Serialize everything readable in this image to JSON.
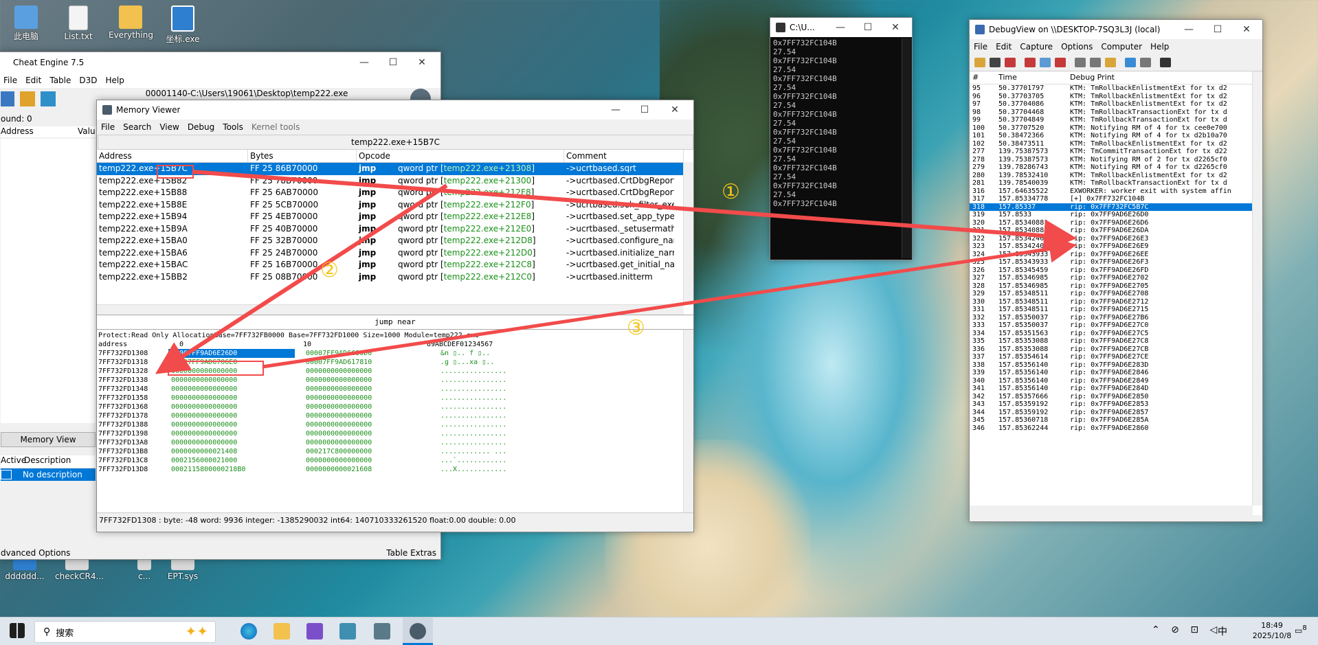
{
  "desktop_icons": [
    {
      "label": "此电脑"
    },
    {
      "label": "List.txt"
    },
    {
      "label": "Everything"
    },
    {
      "label": "坐标.exe"
    },
    {
      "label": "dddddd..."
    },
    {
      "label": "checkCR4..."
    },
    {
      "label": "c..."
    },
    {
      "label": "EPT.sys"
    }
  ],
  "cheat_engine": {
    "title": "Cheat Engine 7.5",
    "menu": [
      "File",
      "Edit",
      "Table",
      "D3D",
      "Help"
    ],
    "process": "00001140-C:\\Users\\19061\\Desktop\\temp222.exe",
    "found": "ound: 0",
    "col_address": "Address",
    "col_value": "Valu",
    "memory_view_button": "Memory View",
    "table_cols": [
      "Active",
      "Description"
    ],
    "table_row": "No description",
    "advanced_options": "dvanced Options",
    "table_extras": "Table Extras"
  },
  "memory_viewer": {
    "title": "Memory Viewer",
    "menu": [
      "File",
      "Search",
      "View",
      "Debug",
      "Tools",
      "Kernel tools"
    ],
    "address_bar": "temp222.exe+15B7C",
    "columns": [
      "Address",
      "Bytes",
      "Opcode",
      "Comment"
    ],
    "rows": [
      {
        "addr": "temp222.exe+15B7C",
        "bytes": "FF 25 86B70000",
        "op": "jmp",
        "pre": "qword ptr [",
        "target": "temp222.exe+21308",
        "post": "]",
        "comment": "->ucrtbased.sqrt"
      },
      {
        "addr": "temp222.exe+15B82",
        "bytes": "FF 25 78B70000",
        "op": "jmp",
        "pre": "qword ptr [",
        "target": "temp222.exe+21300",
        "post": "]",
        "comment": "->ucrtbased.CrtDbgReport"
      },
      {
        "addr": "temp222.exe+15B88",
        "bytes": "FF 25 6AB70000",
        "op": "jmp",
        "pre": "qword ptr [",
        "target": "temp222.exe+212F8",
        "post": "]",
        "comment": "->ucrtbased.CrtDbgReportW"
      },
      {
        "addr": "temp222.exe+15B8E",
        "bytes": "FF 25 5CB70000",
        "op": "jmp",
        "pre": "qword ptr [",
        "target": "temp222.exe+212F0",
        "post": "]",
        "comment": "->ucrtbased.seh_filter_exe"
      },
      {
        "addr": "temp222.exe+15B94",
        "bytes": "FF 25 4EB70000",
        "op": "jmp",
        "pre": "qword ptr [",
        "target": "temp222.exe+212E8",
        "post": "]",
        "comment": "->ucrtbased.set_app_type"
      },
      {
        "addr": "temp222.exe+15B9A",
        "bytes": "FF 25 40B70000",
        "op": "jmp",
        "pre": "qword ptr [",
        "target": "temp222.exe+212E0",
        "post": "]",
        "comment": "->ucrtbased._setusermathe"
      },
      {
        "addr": "temp222.exe+15BA0",
        "bytes": "FF 25 32B70000",
        "op": "jmp",
        "pre": "qword ptr [",
        "target": "temp222.exe+212D8",
        "post": "]",
        "comment": "->ucrtbased.configure_narr"
      },
      {
        "addr": "temp222.exe+15BA6",
        "bytes": "FF 25 24B70000",
        "op": "jmp",
        "pre": "qword ptr [",
        "target": "temp222.exe+212D0",
        "post": "]",
        "comment": "->ucrtbased.initialize_narrov"
      },
      {
        "addr": "temp222.exe+15BAC",
        "bytes": "FF 25 16B70000",
        "op": "jmp",
        "pre": "qword ptr [",
        "target": "temp222.exe+212C8",
        "post": "]",
        "comment": "->ucrtbased.get_initial_narr"
      },
      {
        "addr": "temp222.exe+15BB2",
        "bytes": "FF 25 08B70000",
        "op": "jmp",
        "pre": "qword ptr [",
        "target": "temp222.exe+212C0",
        "post": "]",
        "comment": "->ucrtbased.initterm"
      }
    ],
    "status_instr": "jump near",
    "hex_header": "Protect:Read Only  AllocationBase=7FF732FB0000 Base=7FF732FD1000 Size=1000 Module=temp222.exe",
    "hex_cols": [
      "address",
      "0",
      "10",
      "89ABCDEF01234567"
    ],
    "hex_rows": [
      {
        "addr": "7FF732FD1308",
        "a": "00007FF9AD6E26D0",
        "b": "00007FF9AD6690D0",
        "ascii": "&n  ▯..  f  ▯.."
      },
      {
        "addr": "7FF732FD1318",
        "a": "00007FF9AD6706E0",
        "b": "00007FF9AD617810",
        "ascii": ".g  ▯...xa  ▯.."
      },
      {
        "addr": "7FF732FD1328",
        "a": "0000000000000000",
        "b": "0000000000000000",
        "ascii": "................"
      },
      {
        "addr": "7FF732FD1338",
        "a": "0000000000000000",
        "b": "0000000000000000",
        "ascii": "................"
      },
      {
        "addr": "7FF732FD1348",
        "a": "0000000000000000",
        "b": "0000000000000000",
        "ascii": "................"
      },
      {
        "addr": "7FF732FD1358",
        "a": "0000000000000000",
        "b": "0000000000000000",
        "ascii": "................"
      },
      {
        "addr": "7FF732FD1368",
        "a": "0000000000000000",
        "b": "0000000000000000",
        "ascii": "................"
      },
      {
        "addr": "7FF732FD1378",
        "a": "0000000000000000",
        "b": "0000000000000000",
        "ascii": "................"
      },
      {
        "addr": "7FF732FD1388",
        "a": "0000000000000000",
        "b": "0000000000000000",
        "ascii": "................"
      },
      {
        "addr": "7FF732FD1398",
        "a": "0000000000000000",
        "b": "0000000000000000",
        "ascii": "................"
      },
      {
        "addr": "7FF732FD13A8",
        "a": "0000000000000000",
        "b": "0000000000000000",
        "ascii": "................"
      },
      {
        "addr": "7FF732FD13B8",
        "a": "0000000000021408",
        "b": "000217C800000000",
        "ascii": "............ ..."
      },
      {
        "addr": "7FF732FD13C8",
        "a": "0002156000021000",
        "b": "0000000000000000",
        "ascii": "...`............"
      },
      {
        "addr": "7FF732FD13D8",
        "a": "0002115800000218B0",
        "b": "0000000000021608",
        "ascii": "...X............"
      }
    ],
    "status_bar": "7FF732FD1308 : byte: -48 word: 9936 integer: -1385290032 int64: 140710333261520 float:0.00 double: 0.00"
  },
  "console": {
    "title": "C:\\U...",
    "lines": [
      "0x7FF732FC104B",
      "27.54",
      "0x7FF732FC104B",
      "27.54",
      "0x7FF732FC104B",
      "27.54",
      "0x7FF732FC104B",
      "27.54",
      "0x7FF732FC104B",
      "27.54",
      "0x7FF732FC104B",
      "27.54",
      "0x7FF732FC104B",
      "27.54",
      "0x7FF732FC104B",
      "27.54",
      "0x7FF732FC104B",
      "27.54",
      "0x7FF732FC104B"
    ]
  },
  "debugview": {
    "title": "DebugView on \\\\DESKTOP-7SQ3L3J (local)",
    "menu": [
      "File",
      "Edit",
      "Capture",
      "Options",
      "Computer",
      "Help"
    ],
    "columns": [
      "#",
      "Time",
      "Debug Print"
    ],
    "rows": [
      {
        "n": "95",
        "t": "50.37701797",
        "m": "KTM:  TmRollbackEnlistmentExt for tx d2"
      },
      {
        "n": "96",
        "t": "50.37703705",
        "m": "KTM:  TmRollbackEnlistmentExt for tx d2"
      },
      {
        "n": "97",
        "t": "50.37704086",
        "m": "KTM:  TmRollbackEnlistmentExt for tx d2"
      },
      {
        "n": "98",
        "t": "50.37704468",
        "m": "KTM:  TmRollbackTransactionExt for tx d"
      },
      {
        "n": "99",
        "t": "50.37704849",
        "m": "KTM:  TmRollbackTransactionExt for tx d"
      },
      {
        "n": "100",
        "t": "50.37707520",
        "m": "KTM:  Notifying RM of 4 for tx cee0e700"
      },
      {
        "n": "101",
        "t": "50.38472366",
        "m": "KTM:  Notifying RM of 4 for tx d2b10a70"
      },
      {
        "n": "102",
        "t": "50.38473511",
        "m": "KTM:  TmRollbackEnlistmentExt for tx d2"
      },
      {
        "n": "277",
        "t": "139.75387573",
        "m": "KTM:  TmCommitTransactionExt for tx d22"
      },
      {
        "n": "278",
        "t": "139.75387573",
        "m": "KTM:  Notifying RM of 2 for tx d2265cf0"
      },
      {
        "n": "279",
        "t": "139.78286743",
        "m": "KTM:  Notifying RM of 4 for tx d2265cf0"
      },
      {
        "n": "280",
        "t": "139.78532410",
        "m": "KTM:  TmRollbackEnlistmentExt for tx d2"
      },
      {
        "n": "281",
        "t": "139.78540039",
        "m": "KTM:  TmRollbackTransactionExt for tx d"
      },
      {
        "n": "316",
        "t": "157.64635522",
        "m": "EXWORKER: worker exit with system affin"
      },
      {
        "n": "317",
        "t": "157.85334778",
        "m": "[+] 0x7FF732FC104B"
      },
      {
        "n": "318",
        "t": "157.85337",
        "m": "rip: 0x7FF732FC5B7C"
      },
      {
        "n": "319",
        "t": "157.8533",
        "m": "rip: 0x7FF9AD6E26D0"
      },
      {
        "n": "320",
        "t": "157.85340881",
        "m": "rip: 0x7FF9AD6E26D6"
      },
      {
        "n": "321",
        "t": "157.85340881",
        "m": "rip: 0x7FF9AD6E26DA"
      },
      {
        "n": "322",
        "t": "157.85342407",
        "m": "rip: 0x7FF9AD6E26E3"
      },
      {
        "n": "323",
        "t": "157.85342407",
        "m": "rip: 0x7FF9AD6E26E9"
      },
      {
        "n": "324",
        "t": "157.85343933",
        "m": "rip: 0x7FF9AD6E26EE"
      },
      {
        "n": "325",
        "t": "157.85343933",
        "m": "rip: 0x7FF9AD6E26F3"
      },
      {
        "n": "326",
        "t": "157.85345459",
        "m": "rip: 0x7FF9AD6E26FD"
      },
      {
        "n": "327",
        "t": "157.85346985",
        "m": "rip: 0x7FF9AD6E2702"
      },
      {
        "n": "328",
        "t": "157.85346985",
        "m": "rip: 0x7FF9AD6E2705"
      },
      {
        "n": "329",
        "t": "157.85348511",
        "m": "rip: 0x7FF9AD6E2708"
      },
      {
        "n": "330",
        "t": "157.85348511",
        "m": "rip: 0x7FF9AD6E2712"
      },
      {
        "n": "331",
        "t": "157.85348511",
        "m": "rip: 0x7FF9AD6E2715"
      },
      {
        "n": "332",
        "t": "157.85350037",
        "m": "rip: 0x7FF9AD6E27B6"
      },
      {
        "n": "333",
        "t": "157.85350037",
        "m": "rip: 0x7FF9AD6E27C0"
      },
      {
        "n": "334",
        "t": "157.85351563",
        "m": "rip: 0x7FF9AD6E27C5"
      },
      {
        "n": "335",
        "t": "157.85353088",
        "m": "rip: 0x7FF9AD6E27C8"
      },
      {
        "n": "336",
        "t": "157.85353088",
        "m": "rip: 0x7FF9AD6E27CB"
      },
      {
        "n": "337",
        "t": "157.85354614",
        "m": "rip: 0x7FF9AD6E27CE"
      },
      {
        "n": "338",
        "t": "157.85356140",
        "m": "rip: 0x7FF9AD6E283D"
      },
      {
        "n": "339",
        "t": "157.85356140",
        "m": "rip: 0x7FF9AD6E2846"
      },
      {
        "n": "340",
        "t": "157.85356140",
        "m": "rip: 0x7FF9AD6E2849"
      },
      {
        "n": "341",
        "t": "157.85356140",
        "m": "rip: 0x7FF9AD6E284D"
      },
      {
        "n": "342",
        "t": "157.85357666",
        "m": "rip: 0x7FF9AD6E2850"
      },
      {
        "n": "343",
        "t": "157.85359192",
        "m": "rip: 0x7FF9AD6E2853"
      },
      {
        "n": "344",
        "t": "157.85359192",
        "m": "rip: 0x7FF9AD6E2857"
      },
      {
        "n": "345",
        "t": "157.85360718",
        "m": "rip: 0x7FF9AD6E285A"
      },
      {
        "n": "346",
        "t": "157.85362244",
        "m": "rip: 0x7FF9AD6E2860"
      }
    ],
    "selected_row": "318"
  },
  "callouts": [
    "①",
    "②",
    "③"
  ],
  "taskbar": {
    "search": "搜索",
    "time": "18:49",
    "date": "2025/10/8",
    "ime": "中",
    "notif": "8"
  },
  "colors": {
    "accent": "#0078d7",
    "annotation_red": "#f24b4b",
    "annotation_yellow": "#f5c518",
    "jmp_target_green": "#1a8f1a"
  }
}
